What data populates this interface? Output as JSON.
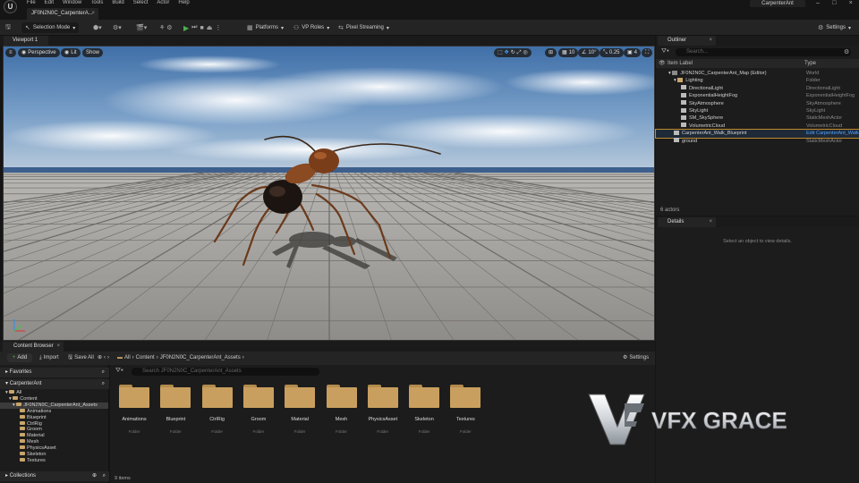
{
  "menu": {
    "items": [
      "File",
      "Edit",
      "Window",
      "Tools",
      "Build",
      "Select",
      "Actor",
      "Help"
    ]
  },
  "doc_tab": {
    "label": "JF0N2N0C_CarpenterA..."
  },
  "project_name": "CarpenterAnt",
  "toolbar": {
    "selection_mode": "Selection Mode",
    "platforms": "Platforms",
    "vp_roles": "VP Roles",
    "pixel_streaming": "Pixel Streaming",
    "settings": "Settings"
  },
  "viewport": {
    "tab_label": "Viewport 1",
    "perspective": "Perspective",
    "lit": "Lit",
    "show": "Show",
    "grid_snap": "10",
    "rotation_snap": "10°",
    "scale_snap": "0.25",
    "camera_speed": "4"
  },
  "outliner": {
    "tab_label": "Outliner",
    "search_placeholder": "Search...",
    "col_label": "Item Label",
    "col_type": "Type",
    "rows": [
      {
        "label": "JF0N2N0C_CarpenterAnt_Map (Editor)",
        "type": "World"
      },
      {
        "label": "Lighting",
        "type": "Folder"
      },
      {
        "label": "DirectionalLight",
        "type": "DirectionalLight"
      },
      {
        "label": "ExponentialHeightFog",
        "type": "ExponentialHeightFog"
      },
      {
        "label": "SkyAtmosphere",
        "type": "SkyAtmosphere"
      },
      {
        "label": "SkyLight",
        "type": "SkyLight"
      },
      {
        "label": "SM_SkySphere",
        "type": "StaticMeshActor"
      },
      {
        "label": "VolumetricCloud",
        "type": "VolumetricCloud"
      },
      {
        "label": "CarpenterAnt_Walk_Blueprint",
        "type": "Edit CarpenterAnt_Walk"
      },
      {
        "label": "ground",
        "type": "StaticMeshActor"
      }
    ],
    "actors_count": "6 actors"
  },
  "details": {
    "tab_label": "Details",
    "empty_message": "Select an object to view details."
  },
  "content_browser": {
    "tab_label": "Content Browser",
    "add": "Add",
    "import": "Import",
    "save_all": "Save All",
    "breadcrumb": [
      "All",
      "Content",
      "JF0N2N0C_CarpenterAnt_Assets"
    ],
    "settings": "Settings",
    "search_placeholder": "Search JF0N2N0C_CarpenterAnt_Assets",
    "favorites": "Favorites",
    "project_section": "CarpenterAnt",
    "collections": "Collections",
    "tree": [
      "All",
      "Content",
      "JF0N2N0C_CarpenterAnt_Assets",
      "Animations",
      "Blueprint",
      "CtrlRig",
      "Groom",
      "Material",
      "Mesh",
      "PhysicsAsset",
      "Skeleton",
      "Textures"
    ],
    "folders": [
      {
        "name": "Animations",
        "kind": "Folder"
      },
      {
        "name": "Blueprint",
        "kind": "Folder"
      },
      {
        "name": "CtrlRig",
        "kind": "Folder"
      },
      {
        "name": "Groom",
        "kind": "Folder"
      },
      {
        "name": "Material",
        "kind": "Folder"
      },
      {
        "name": "Mesh",
        "kind": "Folder"
      },
      {
        "name": "PhysicsAsset",
        "kind": "Folder"
      },
      {
        "name": "Skeleton",
        "kind": "Folder"
      },
      {
        "name": "Textures",
        "kind": "Folder"
      }
    ],
    "items_count": "9 items"
  },
  "watermark": {
    "text": "VFX GRACE"
  },
  "colors": {
    "accent_play": "#4caf50",
    "selection_outline": "#c08a2e",
    "folder": "#c99f5f",
    "link_blue": "#4da3ff"
  }
}
